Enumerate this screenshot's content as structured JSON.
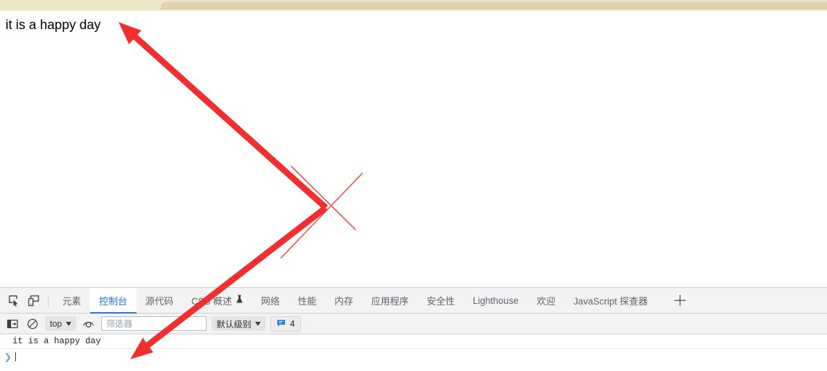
{
  "browser": {
    "tab_strip_color": "#eee5c8",
    "tab_color": "#ddd2ad"
  },
  "page": {
    "text": "it is a happy day"
  },
  "devtools": {
    "toolbar_icons": [
      {
        "name": "inspect-element-icon",
        "title": "检查元素"
      },
      {
        "name": "device-toolbar-icon",
        "title": "设备工具栏"
      }
    ],
    "tabs": [
      {
        "label": "元素",
        "active": false,
        "experimental": false
      },
      {
        "label": "控制台",
        "active": true,
        "experimental": false
      },
      {
        "label": "源代码",
        "active": false,
        "experimental": false
      },
      {
        "label": "CSS 概述",
        "active": false,
        "experimental": true
      },
      {
        "label": "网络",
        "active": false,
        "experimental": false
      },
      {
        "label": "性能",
        "active": false,
        "experimental": false
      },
      {
        "label": "内存",
        "active": false,
        "experimental": false
      },
      {
        "label": "应用程序",
        "active": false,
        "experimental": false
      },
      {
        "label": "安全性",
        "active": false,
        "experimental": false
      },
      {
        "label": "Lighthouse",
        "active": false,
        "experimental": false
      },
      {
        "label": "欢迎",
        "active": false,
        "experimental": false
      },
      {
        "label": "JavaScript 探查器",
        "active": false,
        "experimental": false
      }
    ],
    "add_tab_label": "+",
    "active_tab_accent": "#1a73e8"
  },
  "console_toolbar": {
    "sidebar_toggle": "console-sidebar-icon",
    "clear_console": "clear-console-icon",
    "context_selector": "top",
    "eye_icon": "live-expression-icon",
    "filter": {
      "value": "",
      "placeholder": "筛选器"
    },
    "level_selector": "默认级别",
    "message_badge": {
      "count": "4",
      "icon_color": "#1a73e8"
    }
  },
  "console_body": {
    "messages": [
      {
        "text": "it is a happy day"
      }
    ],
    "prompt_symbol": "❯"
  },
  "annotations": {
    "arrow_color": "#f03030",
    "thin_line_color": "#ef4a4a",
    "arrow_up_target": "page-text",
    "arrow_down_target": "console-message"
  }
}
